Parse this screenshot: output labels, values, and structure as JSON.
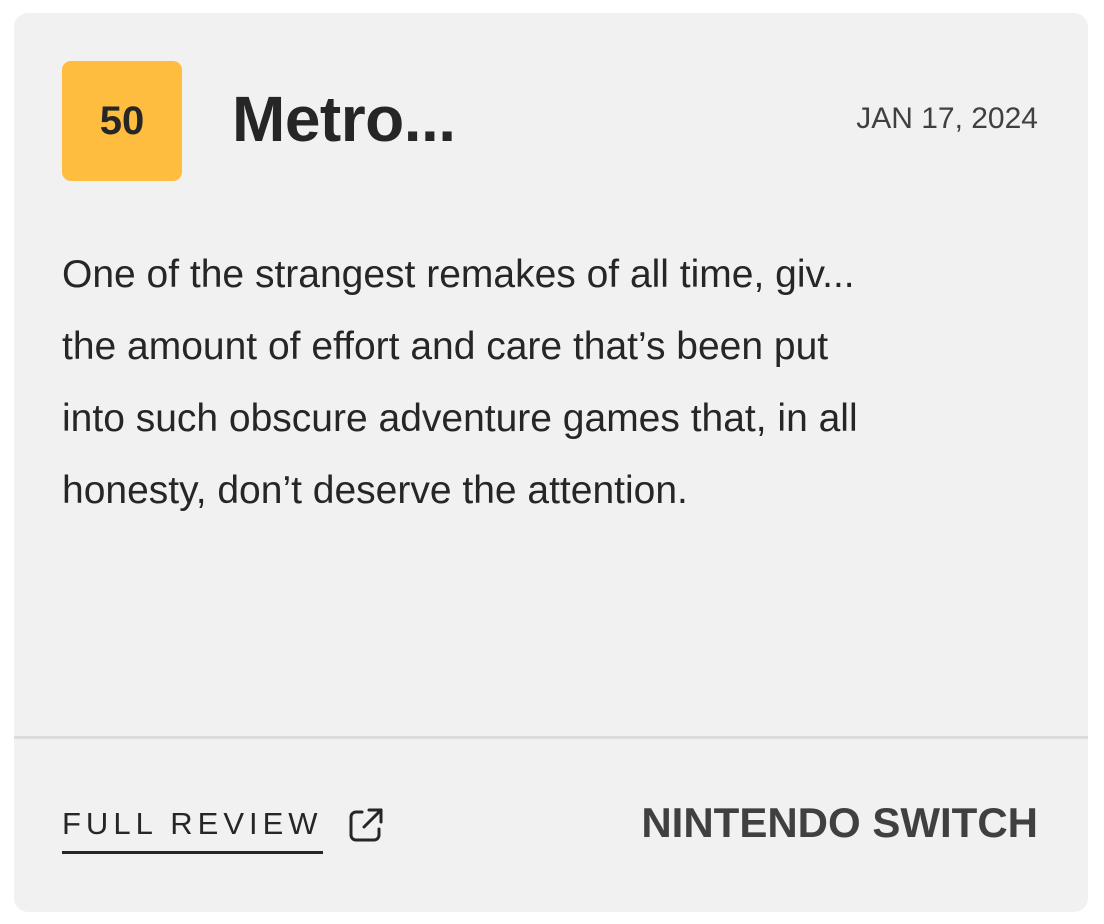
{
  "review": {
    "score": "50",
    "game_title": "Metro...",
    "date": "JAN 17, 2024",
    "quote_lines": [
      "One of the strangest remakes of all time, giv...",
      "the amount of effort and care that’s been put",
      "into such obscure adventure games that, in all",
      "honesty, don’t deserve the attention."
    ],
    "full_review_label": "FULL REVIEW",
    "full_review_icon": "external-link-icon",
    "platform": "NINTENDO SWITCH"
  },
  "colors": {
    "card_background": "#f1f1f1",
    "score_badge": "#ffbd3f",
    "text_primary": "#262626",
    "text_secondary": "#404040",
    "divider": "#dcdcdc"
  }
}
